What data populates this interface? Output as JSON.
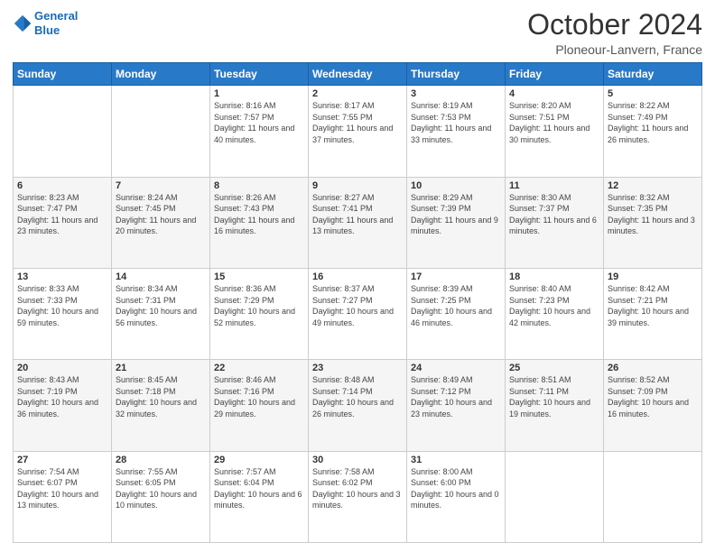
{
  "header": {
    "logo_line1": "General",
    "logo_line2": "Blue",
    "main_title": "October 2024",
    "subtitle": "Ploneour-Lanvern, France"
  },
  "days_of_week": [
    "Sunday",
    "Monday",
    "Tuesday",
    "Wednesday",
    "Thursday",
    "Friday",
    "Saturday"
  ],
  "weeks": [
    [
      {
        "day": "",
        "sunrise": "",
        "sunset": "",
        "daylight": ""
      },
      {
        "day": "",
        "sunrise": "",
        "sunset": "",
        "daylight": ""
      },
      {
        "day": "1",
        "sunrise": "Sunrise: 8:16 AM",
        "sunset": "Sunset: 7:57 PM",
        "daylight": "Daylight: 11 hours and 40 minutes."
      },
      {
        "day": "2",
        "sunrise": "Sunrise: 8:17 AM",
        "sunset": "Sunset: 7:55 PM",
        "daylight": "Daylight: 11 hours and 37 minutes."
      },
      {
        "day": "3",
        "sunrise": "Sunrise: 8:19 AM",
        "sunset": "Sunset: 7:53 PM",
        "daylight": "Daylight: 11 hours and 33 minutes."
      },
      {
        "day": "4",
        "sunrise": "Sunrise: 8:20 AM",
        "sunset": "Sunset: 7:51 PM",
        "daylight": "Daylight: 11 hours and 30 minutes."
      },
      {
        "day": "5",
        "sunrise": "Sunrise: 8:22 AM",
        "sunset": "Sunset: 7:49 PM",
        "daylight": "Daylight: 11 hours and 26 minutes."
      }
    ],
    [
      {
        "day": "6",
        "sunrise": "Sunrise: 8:23 AM",
        "sunset": "Sunset: 7:47 PM",
        "daylight": "Daylight: 11 hours and 23 minutes."
      },
      {
        "day": "7",
        "sunrise": "Sunrise: 8:24 AM",
        "sunset": "Sunset: 7:45 PM",
        "daylight": "Daylight: 11 hours and 20 minutes."
      },
      {
        "day": "8",
        "sunrise": "Sunrise: 8:26 AM",
        "sunset": "Sunset: 7:43 PM",
        "daylight": "Daylight: 11 hours and 16 minutes."
      },
      {
        "day": "9",
        "sunrise": "Sunrise: 8:27 AM",
        "sunset": "Sunset: 7:41 PM",
        "daylight": "Daylight: 11 hours and 13 minutes."
      },
      {
        "day": "10",
        "sunrise": "Sunrise: 8:29 AM",
        "sunset": "Sunset: 7:39 PM",
        "daylight": "Daylight: 11 hours and 9 minutes."
      },
      {
        "day": "11",
        "sunrise": "Sunrise: 8:30 AM",
        "sunset": "Sunset: 7:37 PM",
        "daylight": "Daylight: 11 hours and 6 minutes."
      },
      {
        "day": "12",
        "sunrise": "Sunrise: 8:32 AM",
        "sunset": "Sunset: 7:35 PM",
        "daylight": "Daylight: 11 hours and 3 minutes."
      }
    ],
    [
      {
        "day": "13",
        "sunrise": "Sunrise: 8:33 AM",
        "sunset": "Sunset: 7:33 PM",
        "daylight": "Daylight: 10 hours and 59 minutes."
      },
      {
        "day": "14",
        "sunrise": "Sunrise: 8:34 AM",
        "sunset": "Sunset: 7:31 PM",
        "daylight": "Daylight: 10 hours and 56 minutes."
      },
      {
        "day": "15",
        "sunrise": "Sunrise: 8:36 AM",
        "sunset": "Sunset: 7:29 PM",
        "daylight": "Daylight: 10 hours and 52 minutes."
      },
      {
        "day": "16",
        "sunrise": "Sunrise: 8:37 AM",
        "sunset": "Sunset: 7:27 PM",
        "daylight": "Daylight: 10 hours and 49 minutes."
      },
      {
        "day": "17",
        "sunrise": "Sunrise: 8:39 AM",
        "sunset": "Sunset: 7:25 PM",
        "daylight": "Daylight: 10 hours and 46 minutes."
      },
      {
        "day": "18",
        "sunrise": "Sunrise: 8:40 AM",
        "sunset": "Sunset: 7:23 PM",
        "daylight": "Daylight: 10 hours and 42 minutes."
      },
      {
        "day": "19",
        "sunrise": "Sunrise: 8:42 AM",
        "sunset": "Sunset: 7:21 PM",
        "daylight": "Daylight: 10 hours and 39 minutes."
      }
    ],
    [
      {
        "day": "20",
        "sunrise": "Sunrise: 8:43 AM",
        "sunset": "Sunset: 7:19 PM",
        "daylight": "Daylight: 10 hours and 36 minutes."
      },
      {
        "day": "21",
        "sunrise": "Sunrise: 8:45 AM",
        "sunset": "Sunset: 7:18 PM",
        "daylight": "Daylight: 10 hours and 32 minutes."
      },
      {
        "day": "22",
        "sunrise": "Sunrise: 8:46 AM",
        "sunset": "Sunset: 7:16 PM",
        "daylight": "Daylight: 10 hours and 29 minutes."
      },
      {
        "day": "23",
        "sunrise": "Sunrise: 8:48 AM",
        "sunset": "Sunset: 7:14 PM",
        "daylight": "Daylight: 10 hours and 26 minutes."
      },
      {
        "day": "24",
        "sunrise": "Sunrise: 8:49 AM",
        "sunset": "Sunset: 7:12 PM",
        "daylight": "Daylight: 10 hours and 23 minutes."
      },
      {
        "day": "25",
        "sunrise": "Sunrise: 8:51 AM",
        "sunset": "Sunset: 7:11 PM",
        "daylight": "Daylight: 10 hours and 19 minutes."
      },
      {
        "day": "26",
        "sunrise": "Sunrise: 8:52 AM",
        "sunset": "Sunset: 7:09 PM",
        "daylight": "Daylight: 10 hours and 16 minutes."
      }
    ],
    [
      {
        "day": "27",
        "sunrise": "Sunrise: 7:54 AM",
        "sunset": "Sunset: 6:07 PM",
        "daylight": "Daylight: 10 hours and 13 minutes."
      },
      {
        "day": "28",
        "sunrise": "Sunrise: 7:55 AM",
        "sunset": "Sunset: 6:05 PM",
        "daylight": "Daylight: 10 hours and 10 minutes."
      },
      {
        "day": "29",
        "sunrise": "Sunrise: 7:57 AM",
        "sunset": "Sunset: 6:04 PM",
        "daylight": "Daylight: 10 hours and 6 minutes."
      },
      {
        "day": "30",
        "sunrise": "Sunrise: 7:58 AM",
        "sunset": "Sunset: 6:02 PM",
        "daylight": "Daylight: 10 hours and 3 minutes."
      },
      {
        "day": "31",
        "sunrise": "Sunrise: 8:00 AM",
        "sunset": "Sunset: 6:00 PM",
        "daylight": "Daylight: 10 hours and 0 minutes."
      },
      {
        "day": "",
        "sunrise": "",
        "sunset": "",
        "daylight": ""
      },
      {
        "day": "",
        "sunrise": "",
        "sunset": "",
        "daylight": ""
      }
    ]
  ]
}
